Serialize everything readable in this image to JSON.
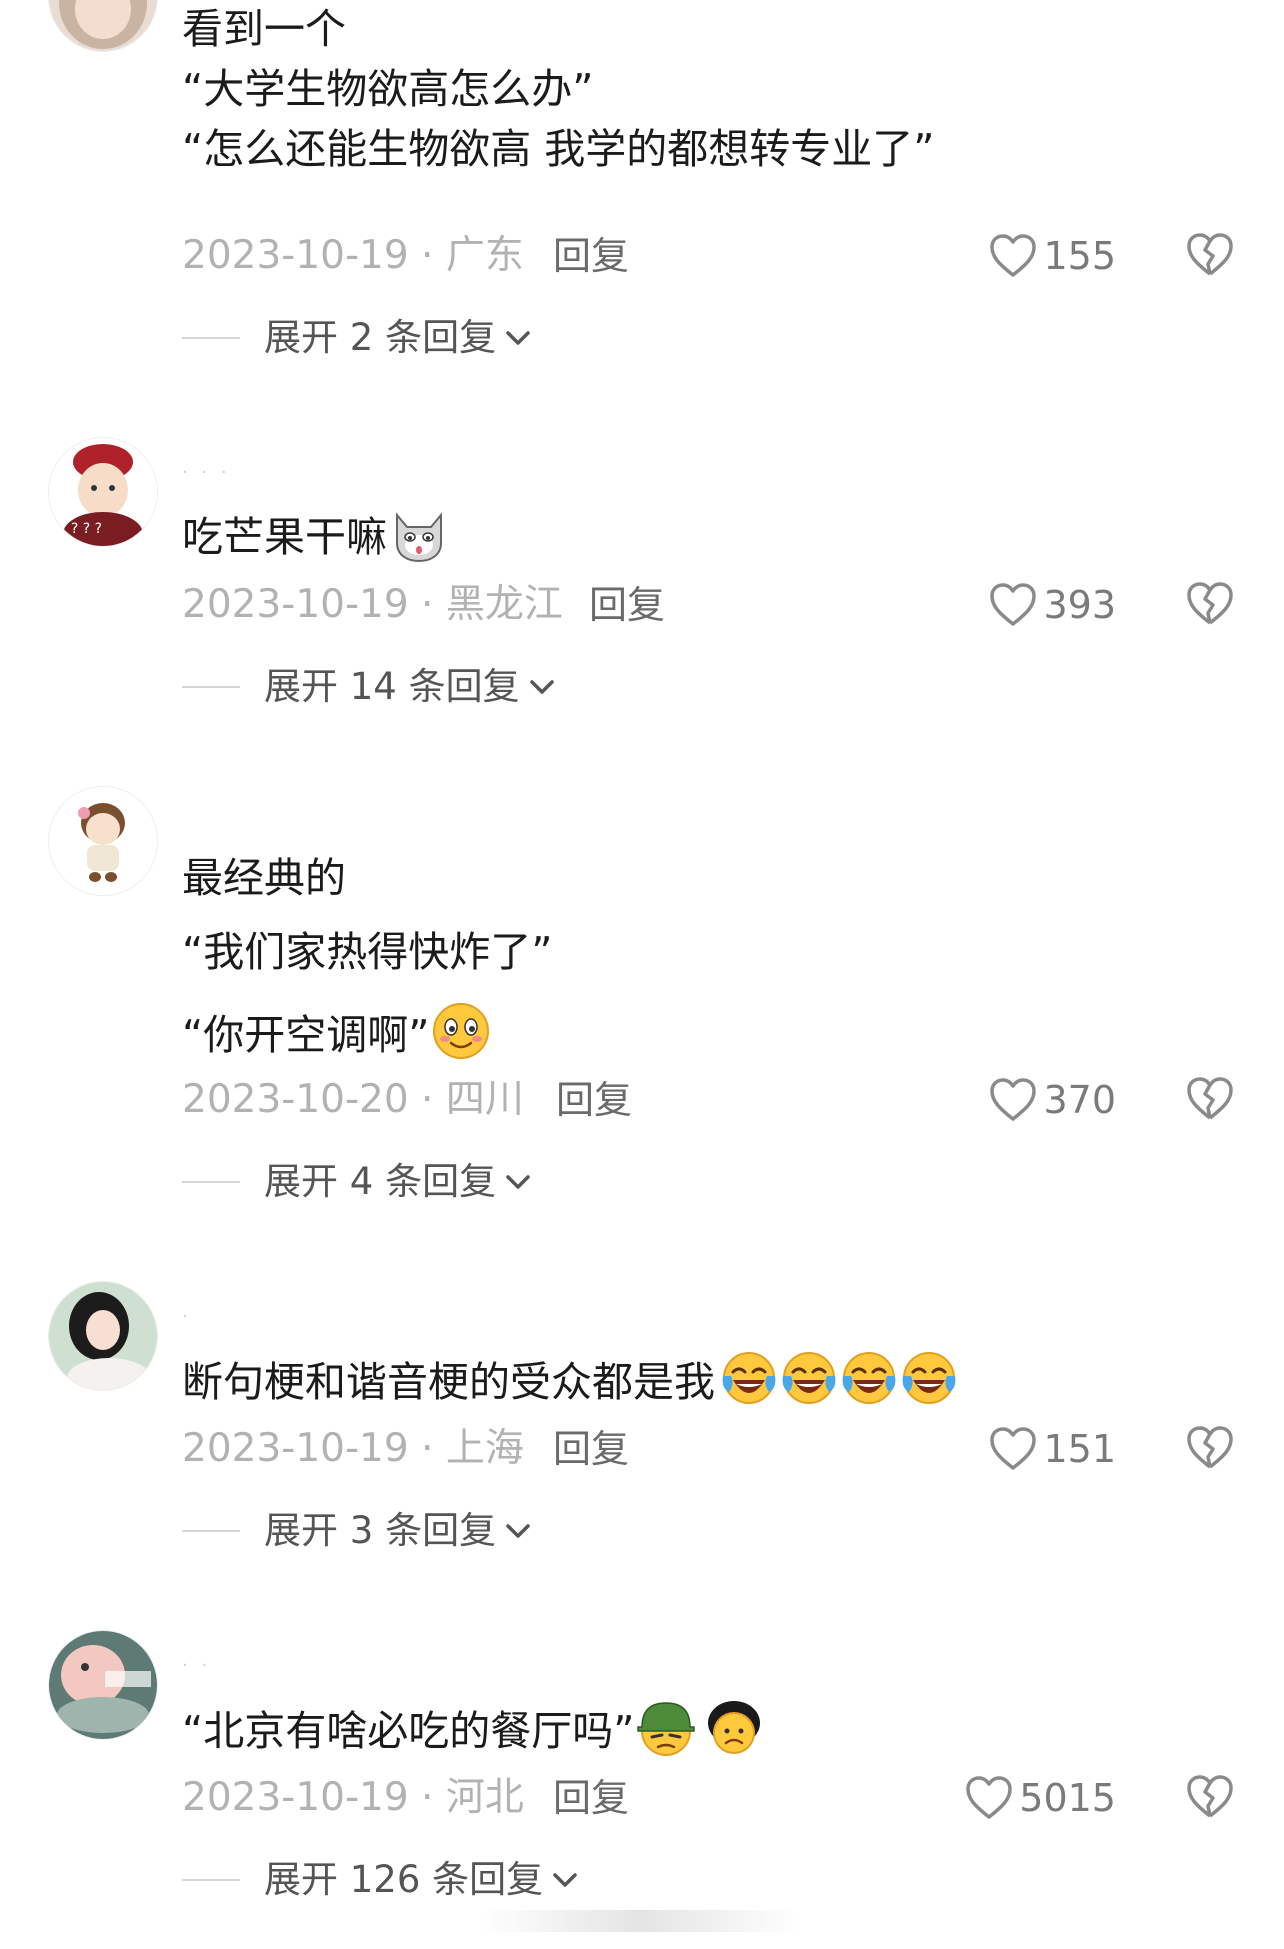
{
  "comments": [
    {
      "lines": [
        "看到一个",
        "“大学生物欲高怎么办”",
        "“怎么还能生物欲高 我学的都想转专业了”"
      ],
      "date": "2023-10-19",
      "location": "广东",
      "reply_label": "回复",
      "likes": "155",
      "expand_label": "展开 2 条回复",
      "emojis": []
    },
    {
      "lines": [
        "吃芒果干嘛"
      ],
      "date": "2023-10-19",
      "location": "黑龙江",
      "reply_label": "回复",
      "likes": "393",
      "expand_label": "展开 14 条回复",
      "emojis": [
        "cat-face-emoji"
      ]
    },
    {
      "lines": [
        "最经典的",
        "“我们家热得快炸了”",
        "“你开空调啊”"
      ],
      "date": "2023-10-20",
      "location": "四川",
      "reply_label": "回复",
      "likes": "370",
      "expand_label": "展开 4 条回复",
      "emojis": [
        "blushing-smile-emoji"
      ]
    },
    {
      "lines": [
        "断句梗和谐音梗的受众都是我"
      ],
      "date": "2023-10-19",
      "location": "上海",
      "reply_label": "回复",
      "likes": "151",
      "expand_label": "展开 3 条回复",
      "emojis": [
        "tears-of-joy-emoji",
        "tears-of-joy-emoji",
        "tears-of-joy-emoji",
        "tears-of-joy-emoji"
      ]
    },
    {
      "lines": [
        "“北京有啥必吃的餐厅吗”"
      ],
      "date": "2023-10-19",
      "location": "河北",
      "reply_label": "回复",
      "likes": "5015",
      "expand_label": "展开 126 条回复",
      "emojis": [
        "soldier-helmet-emoji",
        "frowning-black-face-emoji"
      ]
    }
  ],
  "icons": {
    "like": "heart-outline-icon",
    "dislike": "broken-heart-icon",
    "expand": "chevron-down-icon"
  },
  "colors": {
    "text": "#1b1b1b",
    "meta": "#b2b2b2",
    "reply": "#6a6a6a",
    "emoji_yellow": "#ffc83d"
  }
}
